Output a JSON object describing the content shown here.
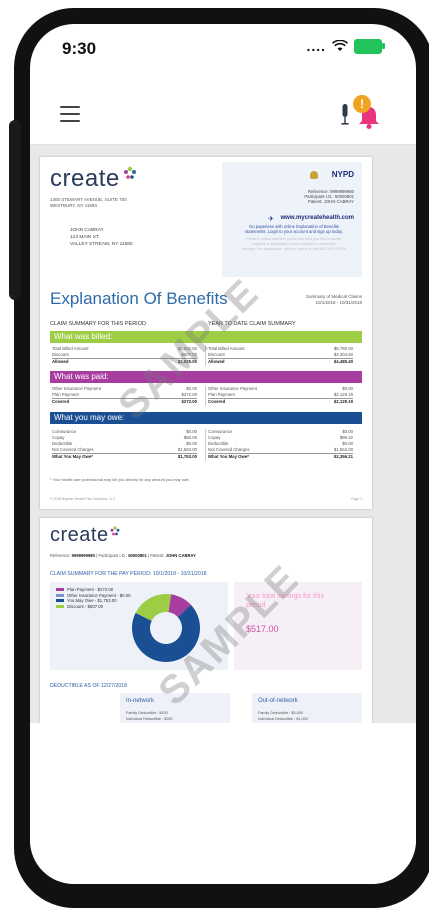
{
  "status_bar": {
    "time": "9:30",
    "signal": "....",
    "battery_color": "#21c35a"
  },
  "app_header": {
    "menu_icon": "hamburger-icon",
    "mic_icon": "microphone-icon",
    "bell_icon": "bell-icon",
    "bell_badge": "!",
    "bell_color": "#e8347f"
  },
  "doc_page1": {
    "logo_text": "create",
    "address_line1": "1400 STEWART AVENUE, SUITE 700",
    "address_line2": "WESTBURY, NY 11590",
    "member_name": "JOHN CABRAY",
    "member_street": "123 MAIN ST.",
    "member_city": "VALLEY STREAM, NY 11580",
    "nypd_label": "NYPD",
    "reference_line": "Reference: 9999999980",
    "participant_line": "Participant I.D.: 60000801",
    "patient_line": "Patient: JOHN CABRAY",
    "website": "www.mycreatehealth.com",
    "paperless_line1": "Go paperless with online Explanation of Benefits",
    "paperless_line2": "statements. Login to your account and sign up today.",
    "faded_line1": "Create's online member portal can help you find a doctor,",
    "faded_line2": "hospital or pharmacy in your network to maximize",
    "faded_line3": "savings. For assistance, call our online or call 844-XXX-XXXX",
    "title": "Explanation Of Benefits",
    "summary_label": "Summary of Medical Claims",
    "summary_dates": "10/1/2018 - 10/31/2018",
    "col_left": "CLAIM SUMMARY FOR THIS PERIOD",
    "col_right": "YEAR TO DATE CLAIM SUMMARY",
    "watermark": "SAMPLE",
    "band_billed": "What was billed:",
    "band_paid": "What was paid:",
    "band_owe": "What you may owe:",
    "billed_left": [
      {
        "label": "Total Billed Amount",
        "value": "$2,592.50"
      },
      {
        "label": "Discount",
        "value": "-$507.00"
      },
      {
        "label": "Allowed",
        "value": "$2,025.00"
      }
    ],
    "billed_right": [
      {
        "label": "Total Billed Amount",
        "value": "$8,750.00"
      },
      {
        "label": "Discount",
        "value": "$4,304.60"
      },
      {
        "label": "Allowed",
        "value": "$4,485.40"
      }
    ],
    "paid_left": [
      {
        "label": "Other Insurance Payment",
        "value": "$0.00"
      },
      {
        "label": "Plan Payment",
        "value": "$272.00"
      },
      {
        "label": "Covered",
        "value": "$272.00"
      }
    ],
    "paid_right": [
      {
        "label": "Other Insurance Payment",
        "value": "$0.00"
      },
      {
        "label": "Plan Payment",
        "value": "$2,129.19"
      },
      {
        "label": "Covered",
        "value": "$2,129.19"
      }
    ],
    "owe_left": [
      {
        "label": "Coinsurance",
        "value": "$0.00"
      },
      {
        "label": "Copay",
        "value": "$50.00"
      },
      {
        "label": "Deductible",
        "value": "$0.00"
      },
      {
        "label": "Not Covered Charges",
        "value": "$1,563.00"
      },
      {
        "label": "What You May Owe*",
        "value": "$1,753.00"
      }
    ],
    "owe_right": [
      {
        "label": "Coinsurance",
        "value": "$0.00"
      },
      {
        "label": "Copay",
        "value": "$99.22"
      },
      {
        "label": "Deductible",
        "value": "$0.00"
      },
      {
        "label": "Not Covered Charges",
        "value": "$1,563.00"
      },
      {
        "label": "What You May Owe*",
        "value": "$2,356.21"
      }
    ],
    "footnote": "* Your health care professional may bill you directly for any amount you may owe.",
    "footer_left": "© 2018 Brighter Health Plan Solutions, LLC",
    "footer_right": "Page 1"
  },
  "doc_page2": {
    "logo_text": "create",
    "ref_label": "Reference:",
    "ref_value": "9999999980",
    "participant_label": "Participant I.D.:",
    "participant_value": "60000801",
    "patient_label": "Patient:",
    "patient_value": "JOHN CABRAY",
    "claim_head": "CLAIM SUMMARY FOR THE PAY PERIOD: 10/1/2018 - 10/31/2018",
    "legend": [
      {
        "label": "Plan Payment - $272.00",
        "color": "#a83da0"
      },
      {
        "label": "Other Insurance Payment - $0.00",
        "color": "#7f93c9"
      },
      {
        "label": "You May Owe - $1,753.00",
        "color": "#1b4f94"
      },
      {
        "label": "Discount - $507.00",
        "color": "#9dcd45"
      }
    ],
    "savings_text": "Your total savings for this period",
    "savings_amount": "$517.00",
    "watermark": "SAMPLE",
    "deductible_head": "DEDUCTIBLE AS OF 12/27/2018",
    "in_network_title": "In-network",
    "in_family": "Family Deductible : $100",
    "in_individual": "Individual Deductible : $250",
    "out_network_title": "Out-of-network",
    "out_family": "Family Deductible : $5,000",
    "out_individual": "Individual Deductible : $1,000"
  },
  "chart_data": {
    "type": "pie",
    "categories": [
      "Plan Payment",
      "Other Insurance Payment",
      "You May Owe",
      "Discount"
    ],
    "values": [
      272,
      0,
      1753,
      507
    ],
    "colors": [
      "#a83da0",
      "#7f93c9",
      "#1b4f94",
      "#9dcd45"
    ]
  }
}
